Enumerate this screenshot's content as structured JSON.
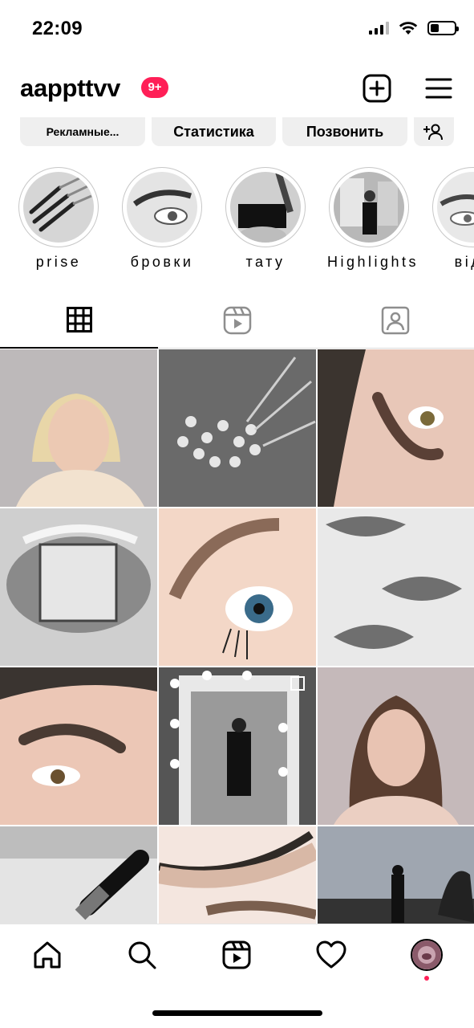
{
  "status_bar": {
    "time": "22:09",
    "battery_level": 0.35
  },
  "header": {
    "username": "aappttvv",
    "notification_badge": "9+"
  },
  "actions": {
    "ads_label": "Рекламные...",
    "stats_label": "Статистика",
    "call_label": "Позвонить"
  },
  "highlights": [
    {
      "label": "prise"
    },
    {
      "label": "бровки"
    },
    {
      "label": "тату"
    },
    {
      "label": "Highlights"
    },
    {
      "label": "відг"
    }
  ],
  "tabs": [
    "grid-icon",
    "reels-icon",
    "tagged-icon"
  ],
  "grid_posts": [
    {
      "desc": "blonde girl portrait"
    },
    {
      "desc": "microbrushes bw"
    },
    {
      "desc": "eye brow closeup"
    },
    {
      "desc": "lips ice cube"
    },
    {
      "desc": "eye lashes color"
    },
    {
      "desc": "glossy lips drawing"
    },
    {
      "desc": "brows closeup"
    },
    {
      "desc": "mirror selfie"
    },
    {
      "desc": "brunette portrait"
    },
    {
      "desc": "brush bw"
    },
    {
      "desc": "lash line closeup"
    },
    {
      "desc": "sunset silhouette"
    }
  ],
  "bottom_nav": [
    "home-icon",
    "search-icon",
    "reels-icon",
    "heart-icon",
    "profile-avatar"
  ],
  "colors": {
    "badge": "#ff1f57",
    "button_bg": "#efefef"
  }
}
